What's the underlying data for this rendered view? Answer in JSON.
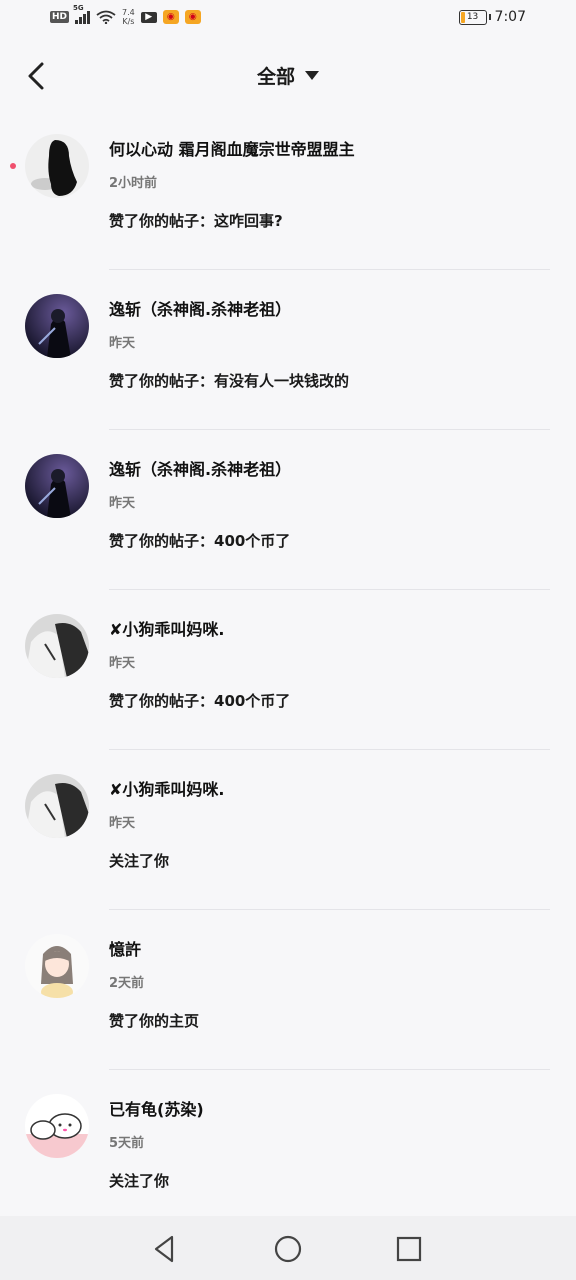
{
  "status_bar": {
    "hd": "HD",
    "net": "5G",
    "speed_value": "7.4",
    "speed_unit": "K/s",
    "battery": "13",
    "time": "7:07"
  },
  "header": {
    "title": "全部"
  },
  "notifications": [
    {
      "name": "何以心动 霜月阁血魔宗世帝盟盟主",
      "time": "2小时前",
      "action": "赞了你的帖子：这咋回事?",
      "unread": true
    },
    {
      "name": "逸斩（杀神阁.杀神老祖）",
      "time": "昨天",
      "action": "赞了你的帖子：有没有人一块钱改的",
      "unread": false
    },
    {
      "name": "逸斩（杀神阁.杀神老祖）",
      "time": "昨天",
      "action": "赞了你的帖子：400个币了",
      "unread": false
    },
    {
      "name": "✘小狗乖叫妈咪.",
      "time": "昨天",
      "action": "赞了你的帖子：400个币了",
      "unread": false
    },
    {
      "name": "✘小狗乖叫妈咪.",
      "time": "昨天",
      "action": "关注了你",
      "unread": false
    },
    {
      "name": "憶許",
      "time": "2天前",
      "action": "赞了你的主页",
      "unread": false
    },
    {
      "name": "已有龟(苏染)",
      "time": "5天前",
      "action": "关注了你",
      "unread": false
    }
  ]
}
